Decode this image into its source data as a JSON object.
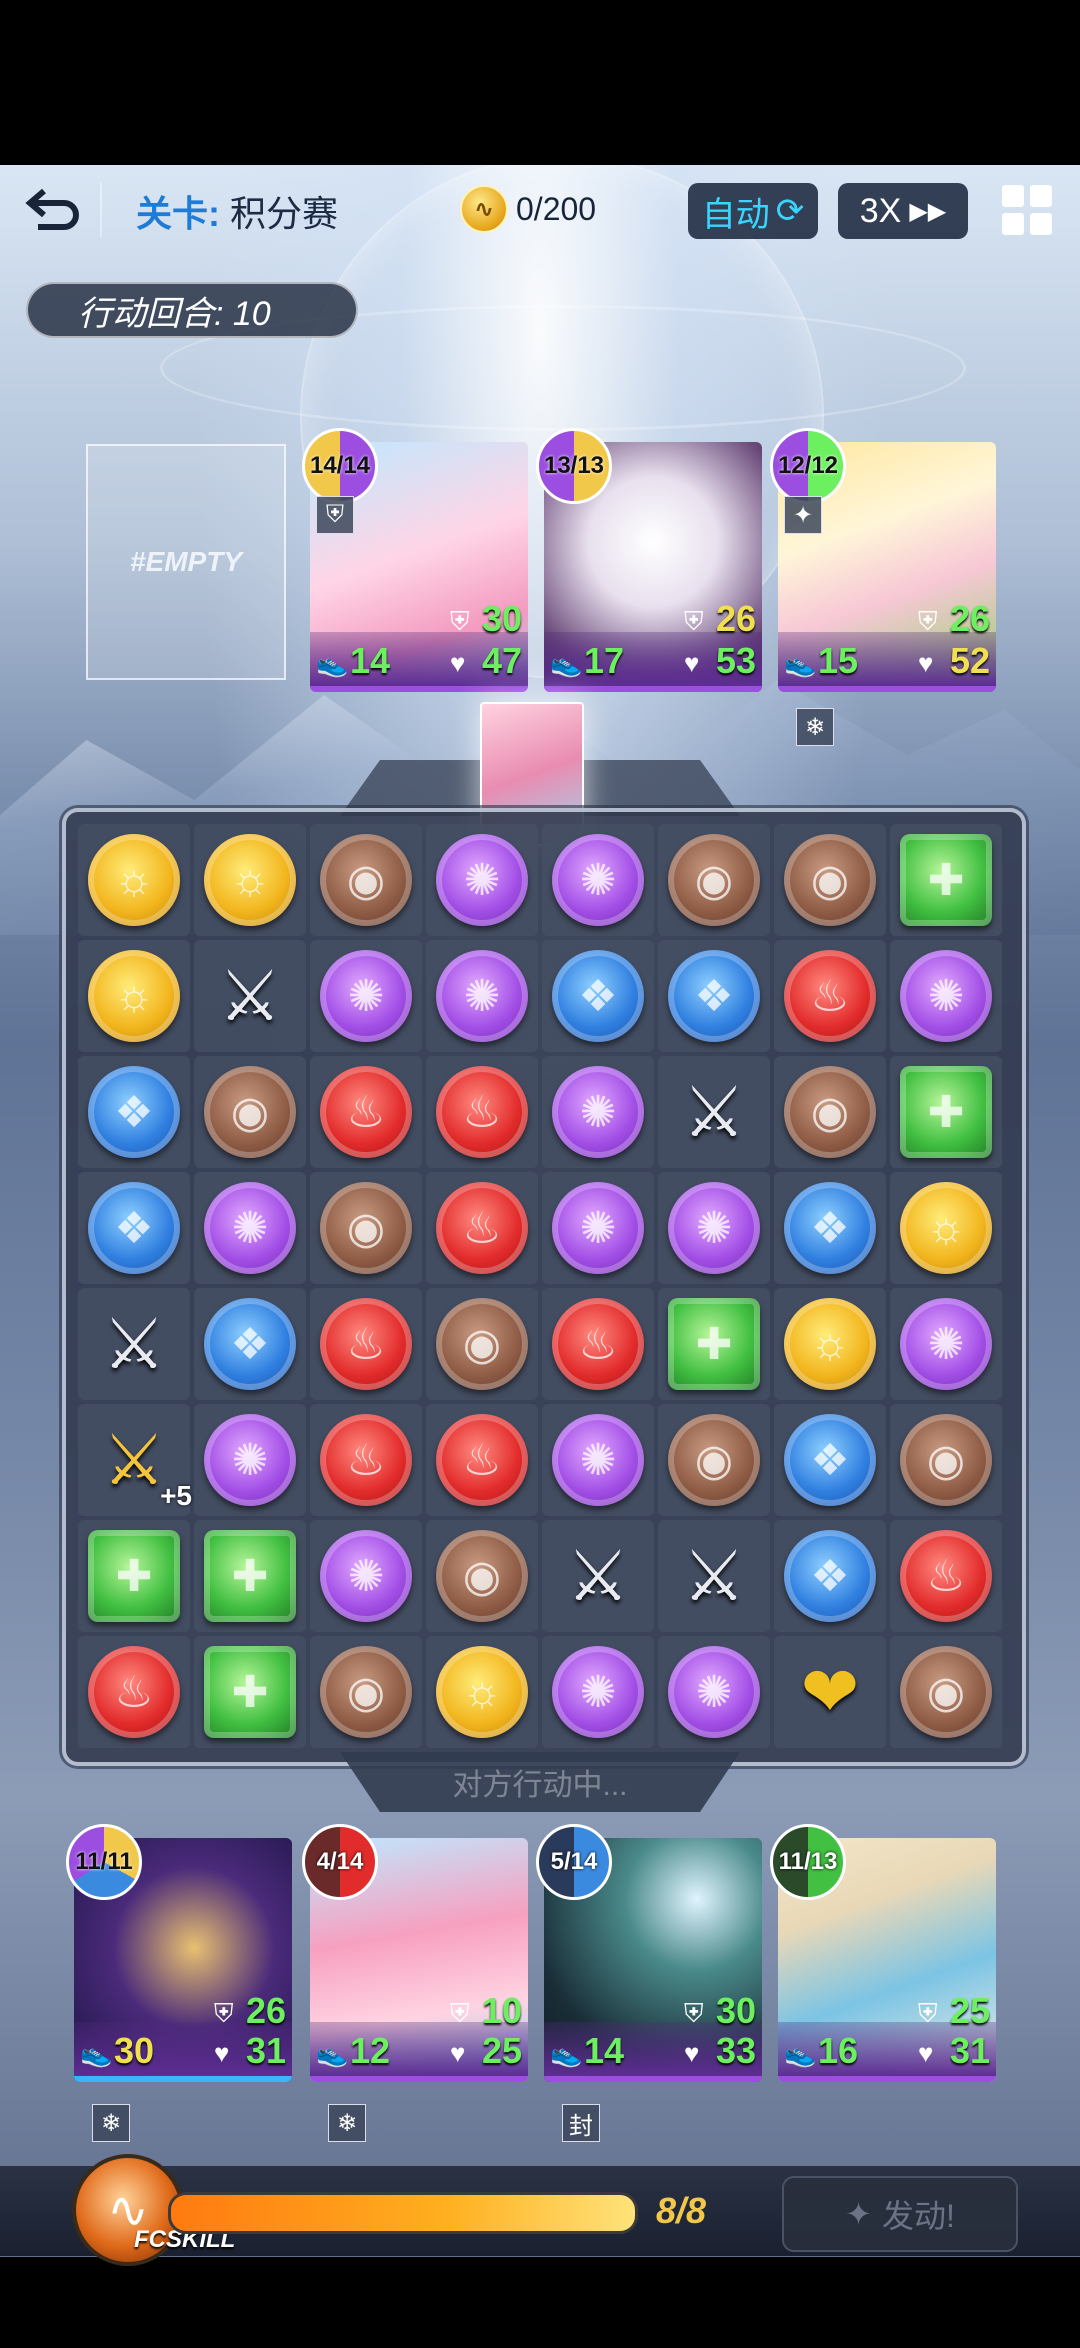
{
  "topbar": {
    "back_icon": "back-arrow-icon",
    "level_key": "关卡:",
    "level_value": "积分赛",
    "coins": "0/200",
    "auto": "自动",
    "speed": "3X",
    "menu_icon": "grid-menu-icon"
  },
  "turn": "行动回合: 10",
  "empty_slot": "#EMPTY",
  "enemy_cards": [
    {
      "badge": "14/14",
      "shield": "30",
      "speed": "14",
      "hp": "47"
    },
    {
      "badge": "13/13",
      "shield": "26",
      "speed": "17",
      "hp": "53"
    },
    {
      "badge": "12/12",
      "shield": "26",
      "speed": "15",
      "hp": "52"
    }
  ],
  "status_icons": {
    "freeze": "❄",
    "seal": "封"
  },
  "board": {
    "opponent_acting": "对方行动中...",
    "plus_label": "+5",
    "rows": [
      [
        "yellow",
        "yellow",
        "brown",
        "purple",
        "purple",
        "brown",
        "brown",
        "green"
      ],
      [
        "yellow",
        "sword",
        "purple",
        "purple",
        "blue",
        "blue",
        "red",
        "purple"
      ],
      [
        "blue",
        "brown",
        "red",
        "red",
        "purple",
        "sword",
        "brown",
        "green"
      ],
      [
        "blue",
        "purple",
        "brown",
        "red",
        "purple",
        "purple",
        "blue",
        "yellow"
      ],
      [
        "sword",
        "blue",
        "red",
        "brown",
        "red",
        "green",
        "yellow",
        "purple"
      ],
      [
        "gold",
        "purple",
        "red",
        "red",
        "purple",
        "brown",
        "blue",
        "brown"
      ],
      [
        "green",
        "green",
        "purple",
        "brown",
        "sword",
        "sword",
        "blue",
        "red"
      ],
      [
        "red",
        "green",
        "brown",
        "yellow",
        "purple",
        "purple",
        "heart",
        "brown"
      ]
    ]
  },
  "player_cards": [
    {
      "badge": "11/11",
      "shield": "26",
      "speed": "30",
      "hp": "31"
    },
    {
      "badge": "4/14",
      "shield": "10",
      "speed": "12",
      "hp": "25"
    },
    {
      "badge": "5/14",
      "shield": "30",
      "speed": "14",
      "hp": "33"
    },
    {
      "badge": "11/13",
      "shield": "25",
      "speed": "16",
      "hp": "31"
    }
  ],
  "skill": {
    "label": "FCSKILL",
    "energy": "8/8",
    "energy_fraction": 1.0,
    "activate": "发动!"
  },
  "colors": {
    "accent_blue": "#1e7bd6",
    "auto_cyan": "#38d6ff",
    "stat_green": "#6df060",
    "energy_orange": "#ffb020"
  }
}
